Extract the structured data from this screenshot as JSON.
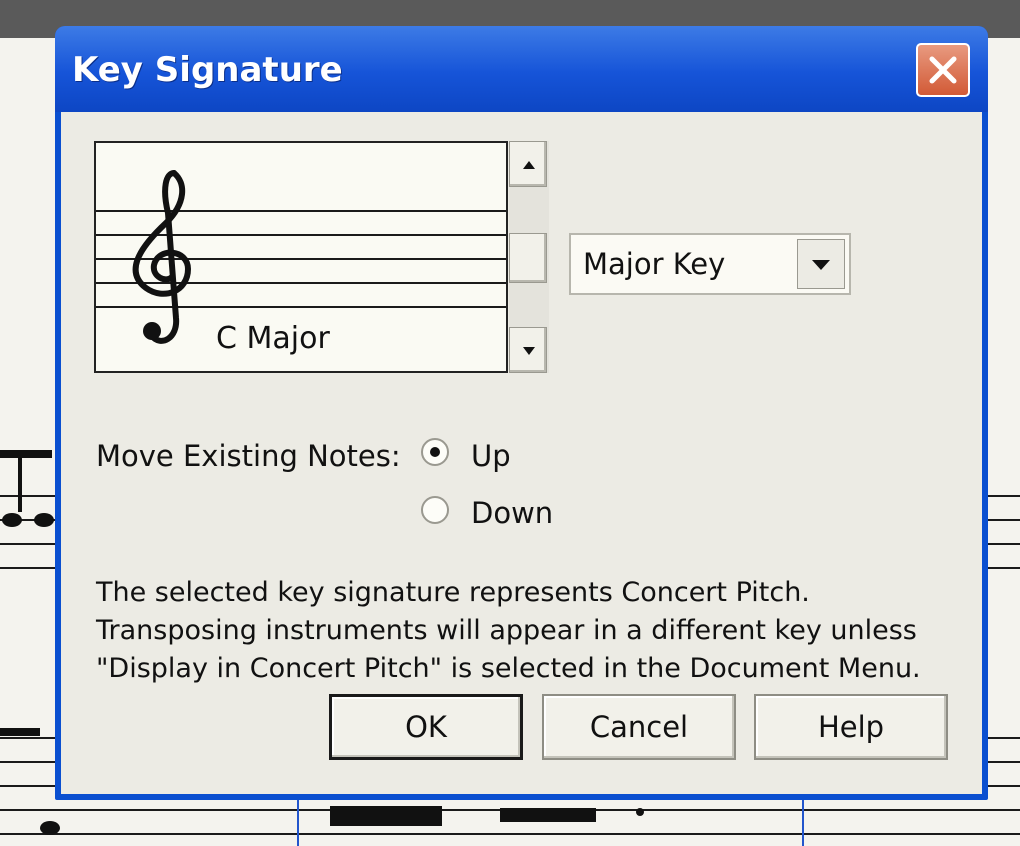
{
  "dialog": {
    "title": "Key Signature",
    "close_icon": "close-icon"
  },
  "preview": {
    "key_name": "C Major",
    "clef_icon": "treble-clef-icon"
  },
  "scrollbar": {
    "up_icon": "arrow-up-icon",
    "down_icon": "arrow-down-icon"
  },
  "mode_select": {
    "value": "Major Key",
    "arrow_icon": "chevron-down-icon"
  },
  "move_notes": {
    "label": "Move Existing Notes:",
    "options": [
      {
        "label": "Up",
        "selected": true
      },
      {
        "label": "Down",
        "selected": false
      }
    ]
  },
  "note": {
    "lines": [
      "The selected key signature represents Concert Pitch.",
      "Transposing instruments will appear in a different key unless",
      "\"Display in Concert Pitch\" is selected in the Document Menu."
    ]
  },
  "buttons": {
    "ok": "OK",
    "cancel": "Cancel",
    "help": "Help"
  },
  "colors": {
    "titlebar": "#1654d8",
    "client": "#ecebe4",
    "close_button": "#d25a36"
  }
}
